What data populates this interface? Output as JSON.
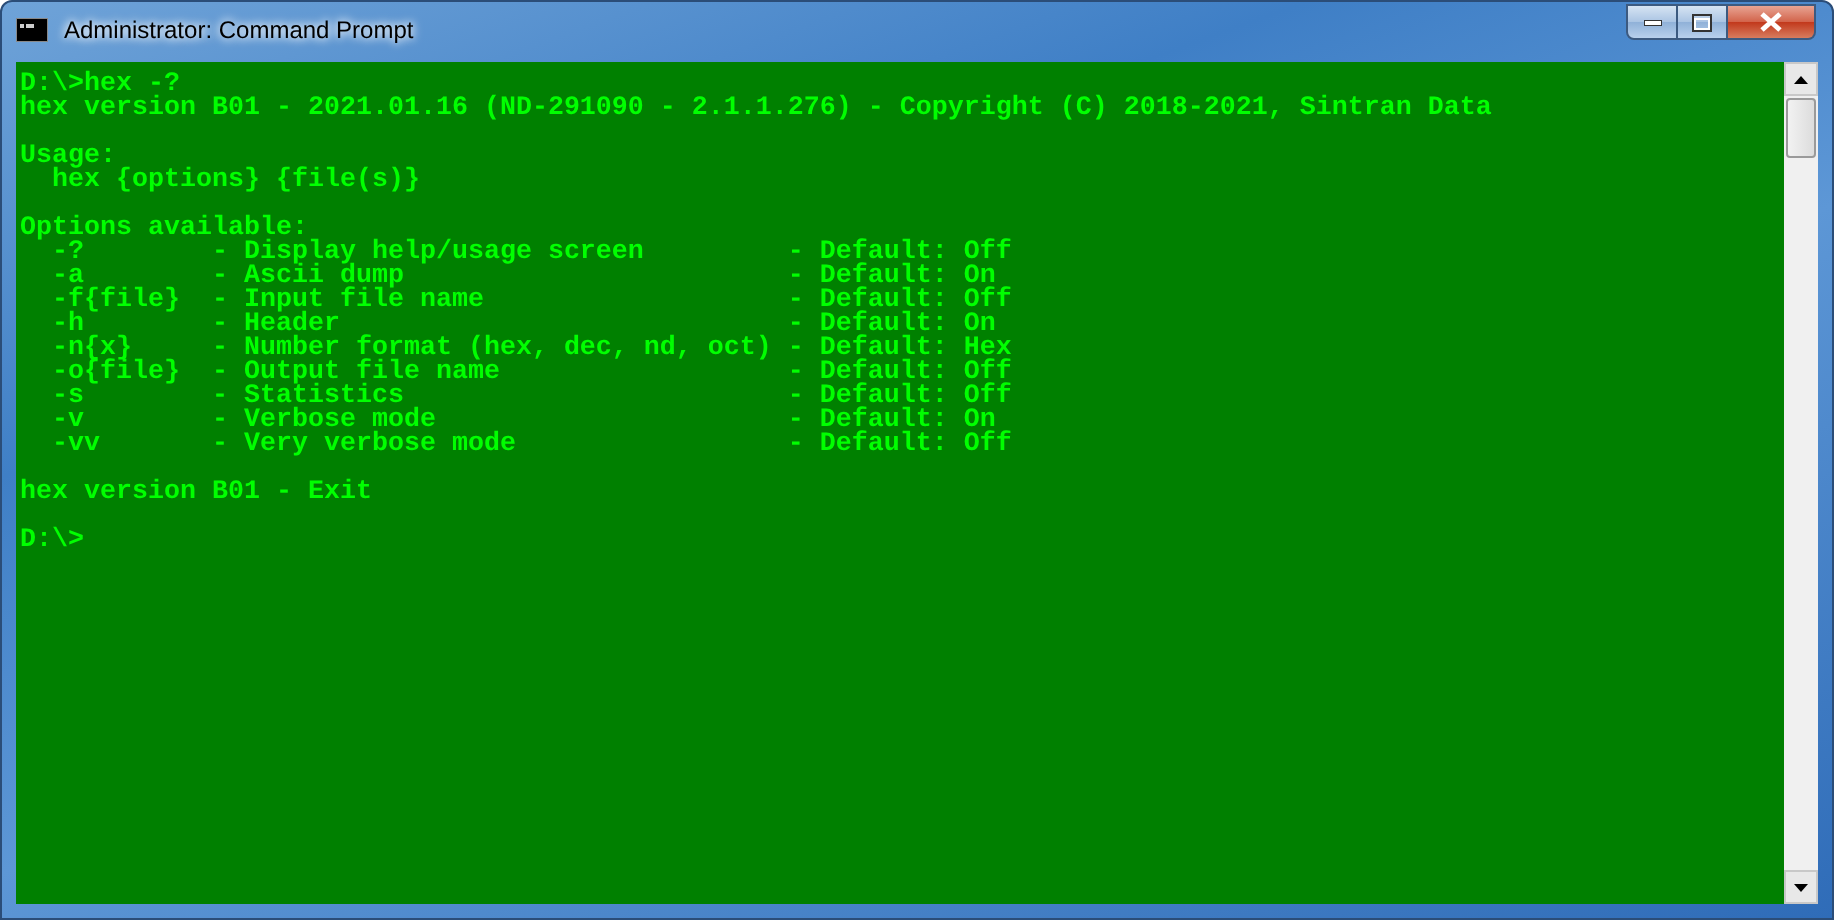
{
  "window": {
    "title": "Administrator: Command Prompt"
  },
  "console": {
    "lines": [
      {
        "kind": "text",
        "text": "D:\\>hex -?"
      },
      {
        "kind": "text",
        "text": "hex version B01 - 2021.01.16 (ND-291090 - 2.1.1.276) - Copyright (C) 2018-2021, Sintran Data"
      },
      {
        "kind": "blank"
      },
      {
        "kind": "text",
        "text": "Usage:"
      },
      {
        "kind": "text",
        "text": "  hex {options} {file(s)}"
      },
      {
        "kind": "blank"
      },
      {
        "kind": "text",
        "text": "Options available:"
      },
      {
        "kind": "text",
        "text": "  -?        - Display help/usage screen         - Default: Off"
      },
      {
        "kind": "text",
        "text": "  -a        - Ascii dump                        - Default: On"
      },
      {
        "kind": "text",
        "text": "  -f{file}  - Input file name                   - Default: Off"
      },
      {
        "kind": "text",
        "text": "  -h        - Header                            - Default: On"
      },
      {
        "kind": "text",
        "text": "  -n{x}     - Number format (hex, dec, nd, oct) - Default: Hex"
      },
      {
        "kind": "text",
        "text": "  -o{file}  - Output file name                  - Default: Off"
      },
      {
        "kind": "text",
        "text": "  -s        - Statistics                        - Default: Off"
      },
      {
        "kind": "text",
        "text": "  -v        - Verbose mode                      - Default: On"
      },
      {
        "kind": "text",
        "text": "  -vv       - Very verbose mode                 - Default: Off"
      },
      {
        "kind": "blank"
      },
      {
        "kind": "text",
        "text": "hex version B01 - Exit"
      },
      {
        "kind": "blank"
      },
      {
        "kind": "text",
        "text": "D:\\>"
      }
    ]
  }
}
